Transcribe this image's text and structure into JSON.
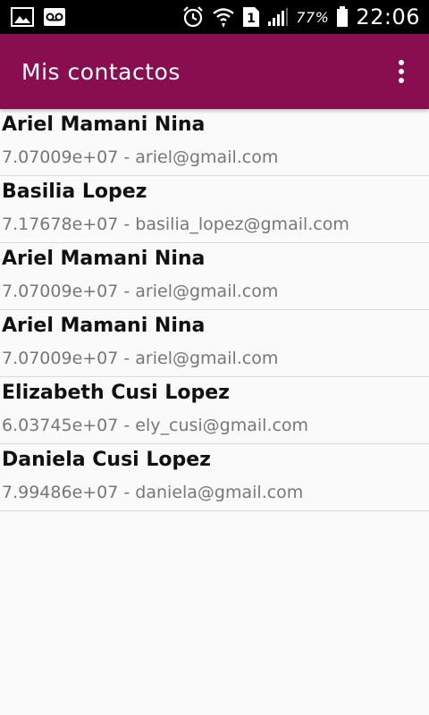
{
  "status_bar": {
    "battery_percent": "77%",
    "time": "22:06",
    "sim_slot": "1",
    "icons": [
      "image-icon",
      "voicemail-icon",
      "alarm-icon",
      "wifi-icon",
      "sim-icon",
      "signal-icon",
      "battery-icon"
    ]
  },
  "app_bar": {
    "title": "Mis contactos",
    "background_color": "#880e4f",
    "overflow_icon": "more-vert-icon"
  },
  "contacts": [
    {
      "name": "Ariel Mamani Nina",
      "detail": "7.07009e+07 - ariel@gmail.com"
    },
    {
      "name": "Basilia Lopez",
      "detail": "7.17678e+07 - basilia_lopez@gmail.com"
    },
    {
      "name": "Ariel Mamani Nina",
      "detail": "7.07009e+07 - ariel@gmail.com"
    },
    {
      "name": "Ariel Mamani Nina",
      "detail": "7.07009e+07 - ariel@gmail.com"
    },
    {
      "name": "Elizabeth Cusi Lopez",
      "detail": "6.03745e+07 - ely_cusi@gmail.com"
    },
    {
      "name": "Daniela Cusi Lopez",
      "detail": "7.99486e+07 - daniela@gmail.com"
    }
  ]
}
